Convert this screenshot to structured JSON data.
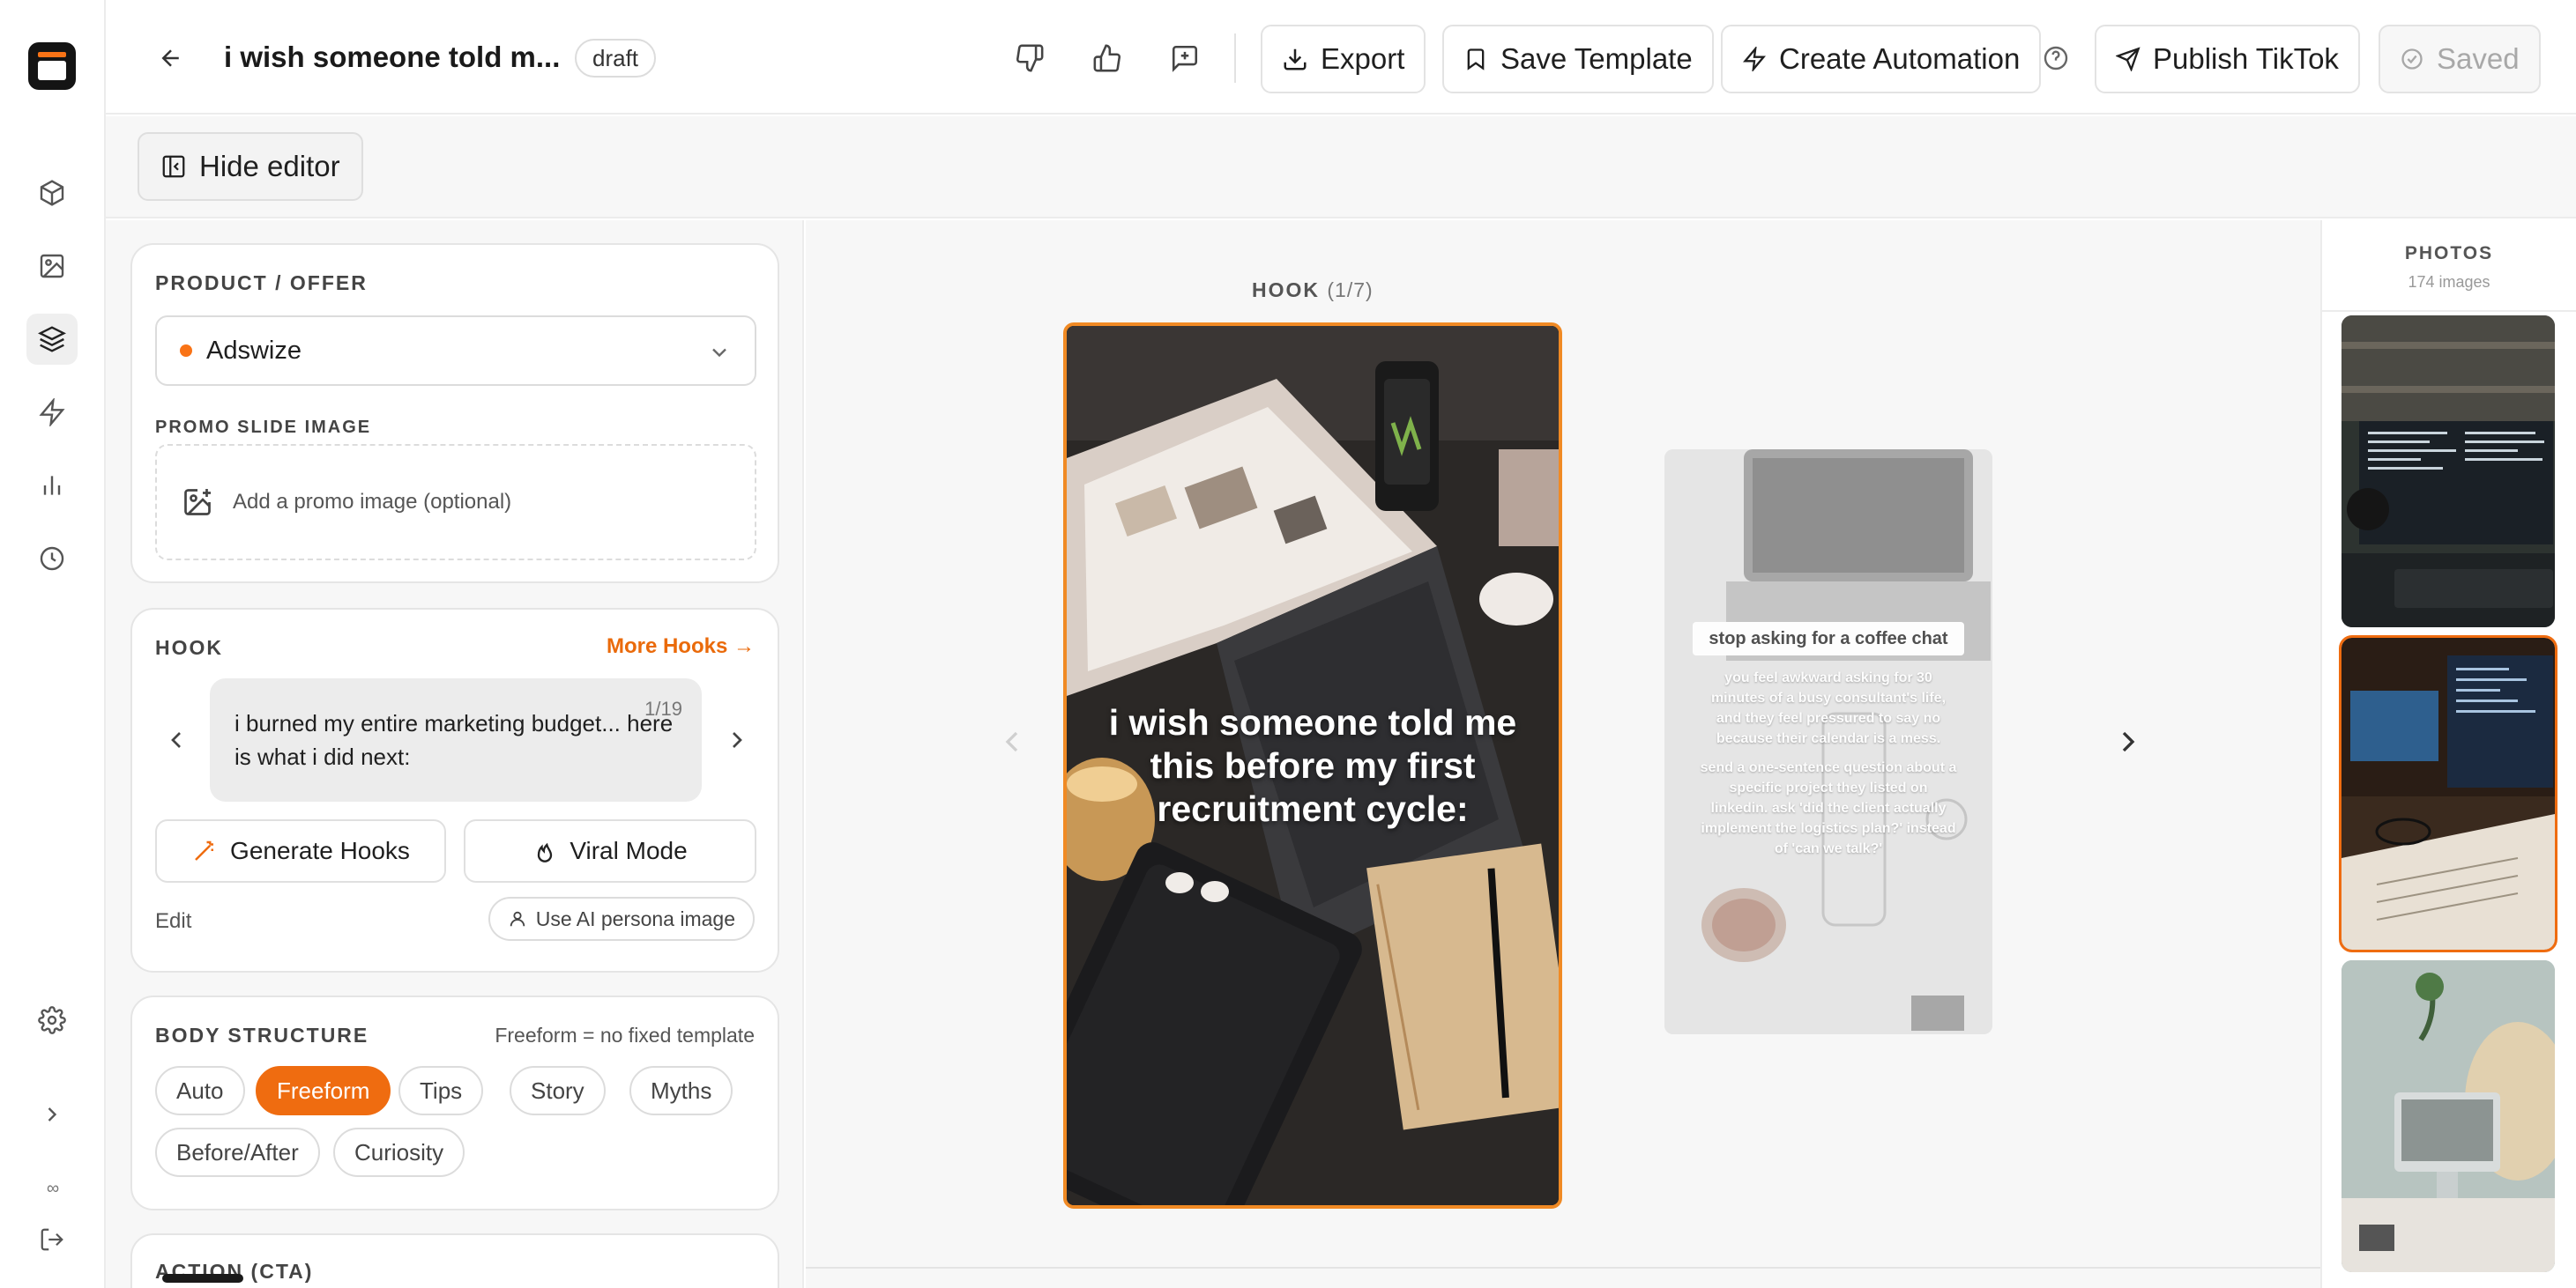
{
  "header": {
    "title": "i wish someone told m...",
    "status_badge": "draft",
    "buttons": {
      "export": "Export",
      "save_template": "Save Template",
      "create_automation": "Create Automation",
      "publish": "Publish TikTok",
      "saved": "Saved"
    }
  },
  "toolbar": {
    "hide_editor": "Hide editor"
  },
  "rail": {
    "infinity": "∞"
  },
  "product": {
    "section_label": "PRODUCT / OFFER",
    "selected": "Adswize",
    "promo_label": "PROMO SLIDE IMAGE",
    "promo_placeholder": "Add a promo image (optional)"
  },
  "hook": {
    "section_label": "HOOK",
    "more_hooks": "More Hooks →",
    "text": "i burned my entire marketing budget... here is what i did next:",
    "counter": "1/19",
    "generate": "Generate Hooks",
    "viral": "Viral Mode",
    "edit": "Edit",
    "persona": "Use AI persona image"
  },
  "body_structure": {
    "section_label": "BODY STRUCTURE",
    "note": "Freeform = no fixed template",
    "options": [
      "Auto",
      "Freeform",
      "Tips",
      "Story",
      "Myths",
      "Before/After",
      "Curiosity"
    ],
    "selected": "Freeform"
  },
  "cta": {
    "section_label": "ACTION (CTA)"
  },
  "canvas": {
    "slide_label": "HOOK",
    "slide_counter": "(1/7)",
    "main_text": "i wish someone told me this before my first recruitment cycle:",
    "next_title": "stop asking for a coffee chat",
    "next_para1": "you feel awkward asking for 30 minutes of a busy consultant's life, and they feel pressured to say no because their calendar is a mess.",
    "next_para2": "send a one-sentence question about a specific project they listed on linkedin. ask 'did the client actually implement the logistics plan?' instead of 'can we talk?'"
  },
  "photos": {
    "title": "PHOTOS",
    "count": "174 images"
  },
  "colors": {
    "accent": "#ef6c10",
    "selected_border": "#f08a24"
  }
}
